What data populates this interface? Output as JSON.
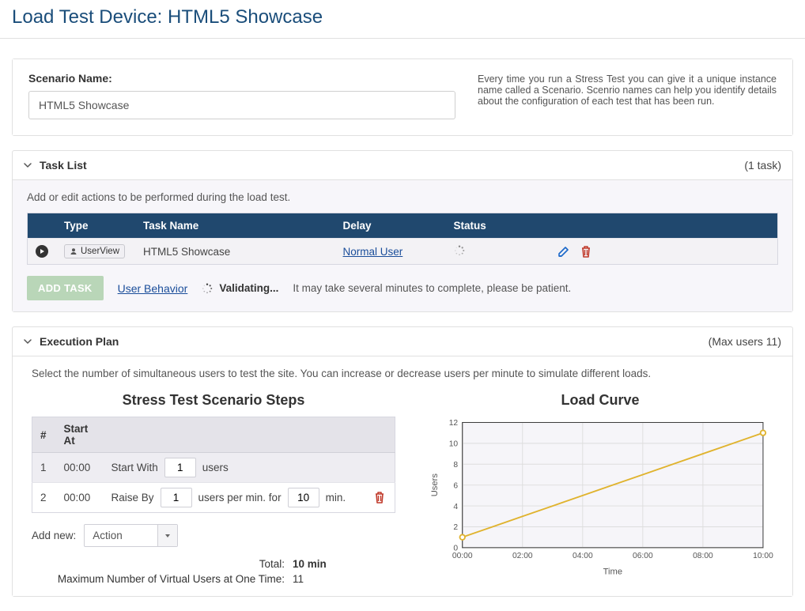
{
  "page": {
    "title": "Load Test Device: HTML5 Showcase"
  },
  "scenario": {
    "label": "Scenario Name:",
    "value": "HTML5 Showcase",
    "help": "Every time you run a Stress Test you can give it a unique instance name called a Scenario. Scenrio names can help you identify details about the configuration of each test that has been run."
  },
  "taskList": {
    "title": "Task List",
    "meta": "(1 task)",
    "subtext": "Add or edit actions to be performed during the load test.",
    "headers": {
      "type": "Type",
      "name": "Task Name",
      "delay": "Delay",
      "status": "Status"
    },
    "row": {
      "badge": "UserView",
      "name": "HTML5 Showcase",
      "delay": "Normal User"
    },
    "addTaskBtn": "ADD TASK",
    "userBehaviorLink": "User Behavior",
    "validating": "Validating...",
    "patient": "It may take several minutes to complete, please be patient."
  },
  "execPlan": {
    "title": "Execution Plan",
    "meta": "(Max users 11)",
    "subtext": "Select the number of simultaneous users to test the site. You can increase or decrease users per minute to simulate different loads.",
    "stepsTitle": "Stress Test Scenario Steps",
    "headers": {
      "num": "#",
      "startAt": "Start At"
    },
    "rows": [
      {
        "num": "1",
        "startAt": "00:00",
        "label": "Start With",
        "value": "1",
        "suffix": "users"
      },
      {
        "num": "2",
        "startAt": "00:00",
        "label": "Raise By",
        "value": "1",
        "mid": "users per min. for",
        "value2": "10",
        "suffix2": "min."
      }
    ],
    "addNewLabel": "Add new:",
    "addNewSelect": "Action",
    "totals": {
      "totalLabel": "Total:",
      "totalValue": "10 min",
      "maxLabel": "Maximum Number of Virtual Users at One Time:",
      "maxValue": "11"
    },
    "chartTitle": "Load Curve",
    "yAxisLabel": "Users",
    "xAxisLabel": "Time"
  },
  "chart_data": {
    "type": "line",
    "x": [
      0,
      1,
      2,
      3,
      4,
      5,
      6,
      7,
      8,
      9,
      10
    ],
    "x_tick_labels": [
      "00:00",
      "02:00",
      "04:00",
      "06:00",
      "08:00",
      "10:00"
    ],
    "values": [
      1,
      2,
      3,
      4,
      5,
      6,
      7,
      8,
      9,
      10,
      11
    ],
    "title": "Load Curve",
    "xlabel": "Time",
    "ylabel": "Users",
    "ylim": [
      0,
      12
    ],
    "xlim": [
      0,
      10
    ],
    "y_ticks": [
      0,
      2,
      4,
      6,
      8,
      10,
      12
    ],
    "x_ticks": [
      0,
      2,
      4,
      6,
      8,
      10
    ]
  }
}
